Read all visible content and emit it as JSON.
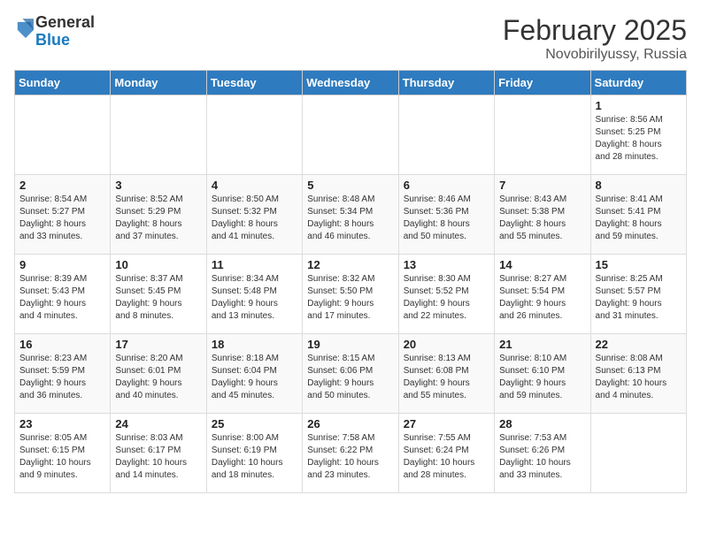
{
  "header": {
    "logo_general": "General",
    "logo_blue": "Blue",
    "month": "February 2025",
    "location": "Novobirilyussy, Russia"
  },
  "days_of_week": [
    "Sunday",
    "Monday",
    "Tuesday",
    "Wednesday",
    "Thursday",
    "Friday",
    "Saturday"
  ],
  "weeks": [
    [
      {
        "day": "",
        "info": ""
      },
      {
        "day": "",
        "info": ""
      },
      {
        "day": "",
        "info": ""
      },
      {
        "day": "",
        "info": ""
      },
      {
        "day": "",
        "info": ""
      },
      {
        "day": "",
        "info": ""
      },
      {
        "day": "1",
        "info": "Sunrise: 8:56 AM\nSunset: 5:25 PM\nDaylight: 8 hours\nand 28 minutes."
      }
    ],
    [
      {
        "day": "2",
        "info": "Sunrise: 8:54 AM\nSunset: 5:27 PM\nDaylight: 8 hours\nand 33 minutes."
      },
      {
        "day": "3",
        "info": "Sunrise: 8:52 AM\nSunset: 5:29 PM\nDaylight: 8 hours\nand 37 minutes."
      },
      {
        "day": "4",
        "info": "Sunrise: 8:50 AM\nSunset: 5:32 PM\nDaylight: 8 hours\nand 41 minutes."
      },
      {
        "day": "5",
        "info": "Sunrise: 8:48 AM\nSunset: 5:34 PM\nDaylight: 8 hours\nand 46 minutes."
      },
      {
        "day": "6",
        "info": "Sunrise: 8:46 AM\nSunset: 5:36 PM\nDaylight: 8 hours\nand 50 minutes."
      },
      {
        "day": "7",
        "info": "Sunrise: 8:43 AM\nSunset: 5:38 PM\nDaylight: 8 hours\nand 55 minutes."
      },
      {
        "day": "8",
        "info": "Sunrise: 8:41 AM\nSunset: 5:41 PM\nDaylight: 8 hours\nand 59 minutes."
      }
    ],
    [
      {
        "day": "9",
        "info": "Sunrise: 8:39 AM\nSunset: 5:43 PM\nDaylight: 9 hours\nand 4 minutes."
      },
      {
        "day": "10",
        "info": "Sunrise: 8:37 AM\nSunset: 5:45 PM\nDaylight: 9 hours\nand 8 minutes."
      },
      {
        "day": "11",
        "info": "Sunrise: 8:34 AM\nSunset: 5:48 PM\nDaylight: 9 hours\nand 13 minutes."
      },
      {
        "day": "12",
        "info": "Sunrise: 8:32 AM\nSunset: 5:50 PM\nDaylight: 9 hours\nand 17 minutes."
      },
      {
        "day": "13",
        "info": "Sunrise: 8:30 AM\nSunset: 5:52 PM\nDaylight: 9 hours\nand 22 minutes."
      },
      {
        "day": "14",
        "info": "Sunrise: 8:27 AM\nSunset: 5:54 PM\nDaylight: 9 hours\nand 26 minutes."
      },
      {
        "day": "15",
        "info": "Sunrise: 8:25 AM\nSunset: 5:57 PM\nDaylight: 9 hours\nand 31 minutes."
      }
    ],
    [
      {
        "day": "16",
        "info": "Sunrise: 8:23 AM\nSunset: 5:59 PM\nDaylight: 9 hours\nand 36 minutes."
      },
      {
        "day": "17",
        "info": "Sunrise: 8:20 AM\nSunset: 6:01 PM\nDaylight: 9 hours\nand 40 minutes."
      },
      {
        "day": "18",
        "info": "Sunrise: 8:18 AM\nSunset: 6:04 PM\nDaylight: 9 hours\nand 45 minutes."
      },
      {
        "day": "19",
        "info": "Sunrise: 8:15 AM\nSunset: 6:06 PM\nDaylight: 9 hours\nand 50 minutes."
      },
      {
        "day": "20",
        "info": "Sunrise: 8:13 AM\nSunset: 6:08 PM\nDaylight: 9 hours\nand 55 minutes."
      },
      {
        "day": "21",
        "info": "Sunrise: 8:10 AM\nSunset: 6:10 PM\nDaylight: 9 hours\nand 59 minutes."
      },
      {
        "day": "22",
        "info": "Sunrise: 8:08 AM\nSunset: 6:13 PM\nDaylight: 10 hours\nand 4 minutes."
      }
    ],
    [
      {
        "day": "23",
        "info": "Sunrise: 8:05 AM\nSunset: 6:15 PM\nDaylight: 10 hours\nand 9 minutes."
      },
      {
        "day": "24",
        "info": "Sunrise: 8:03 AM\nSunset: 6:17 PM\nDaylight: 10 hours\nand 14 minutes."
      },
      {
        "day": "25",
        "info": "Sunrise: 8:00 AM\nSunset: 6:19 PM\nDaylight: 10 hours\nand 18 minutes."
      },
      {
        "day": "26",
        "info": "Sunrise: 7:58 AM\nSunset: 6:22 PM\nDaylight: 10 hours\nand 23 minutes."
      },
      {
        "day": "27",
        "info": "Sunrise: 7:55 AM\nSunset: 6:24 PM\nDaylight: 10 hours\nand 28 minutes."
      },
      {
        "day": "28",
        "info": "Sunrise: 7:53 AM\nSunset: 6:26 PM\nDaylight: 10 hours\nand 33 minutes."
      },
      {
        "day": "",
        "info": ""
      }
    ]
  ]
}
